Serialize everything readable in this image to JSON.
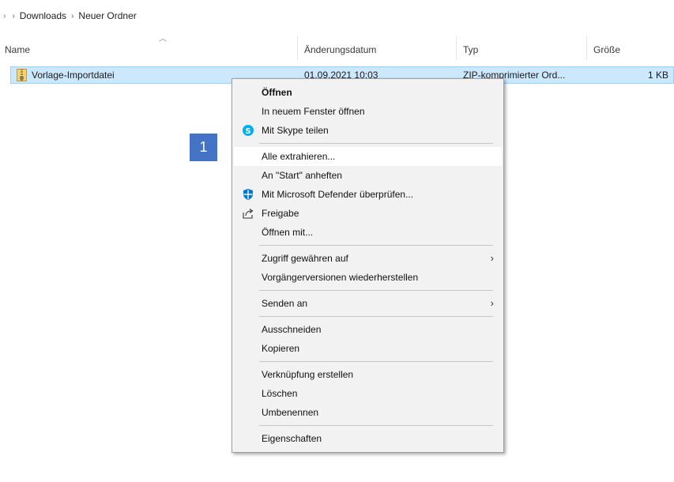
{
  "breadcrumb": {
    "items": [
      "Downloads",
      "Neuer Ordner"
    ]
  },
  "columns": {
    "name": "Name",
    "date": "Änderungsdatum",
    "type": "Typ",
    "size": "Größe"
  },
  "file": {
    "name": "Vorlage-Importdatei",
    "date": "01.09.2021 10:03",
    "type": "ZIP-komprimierter Ord...",
    "size": "1 KB",
    "icon": "zip-folder-icon"
  },
  "callout": {
    "number": "1",
    "color": "#4472c4"
  },
  "context_menu": {
    "open": "Öffnen",
    "open_new_window": "In neuem Fenster öffnen",
    "share_skype": "Mit Skype teilen",
    "extract_all": "Alle extrahieren...",
    "pin_start": "An \"Start\" anheften",
    "defender_scan": "Mit Microsoft Defender überprüfen...",
    "share": "Freigabe",
    "open_with": "Öffnen mit...",
    "give_access": "Zugriff gewähren auf",
    "restore_versions": "Vorgängerversionen wiederherstellen",
    "send_to": "Senden an",
    "cut": "Ausschneiden",
    "copy": "Kopieren",
    "create_shortcut": "Verknüpfung erstellen",
    "delete": "Löschen",
    "rename": "Umbenennen",
    "properties": "Eigenschaften"
  },
  "colors": {
    "selection": "#cce8ff",
    "selection_border": "#99d1ff",
    "skype": "#00aff0",
    "defender": "#0078d4",
    "menu_bg": "#f2f2f2"
  }
}
